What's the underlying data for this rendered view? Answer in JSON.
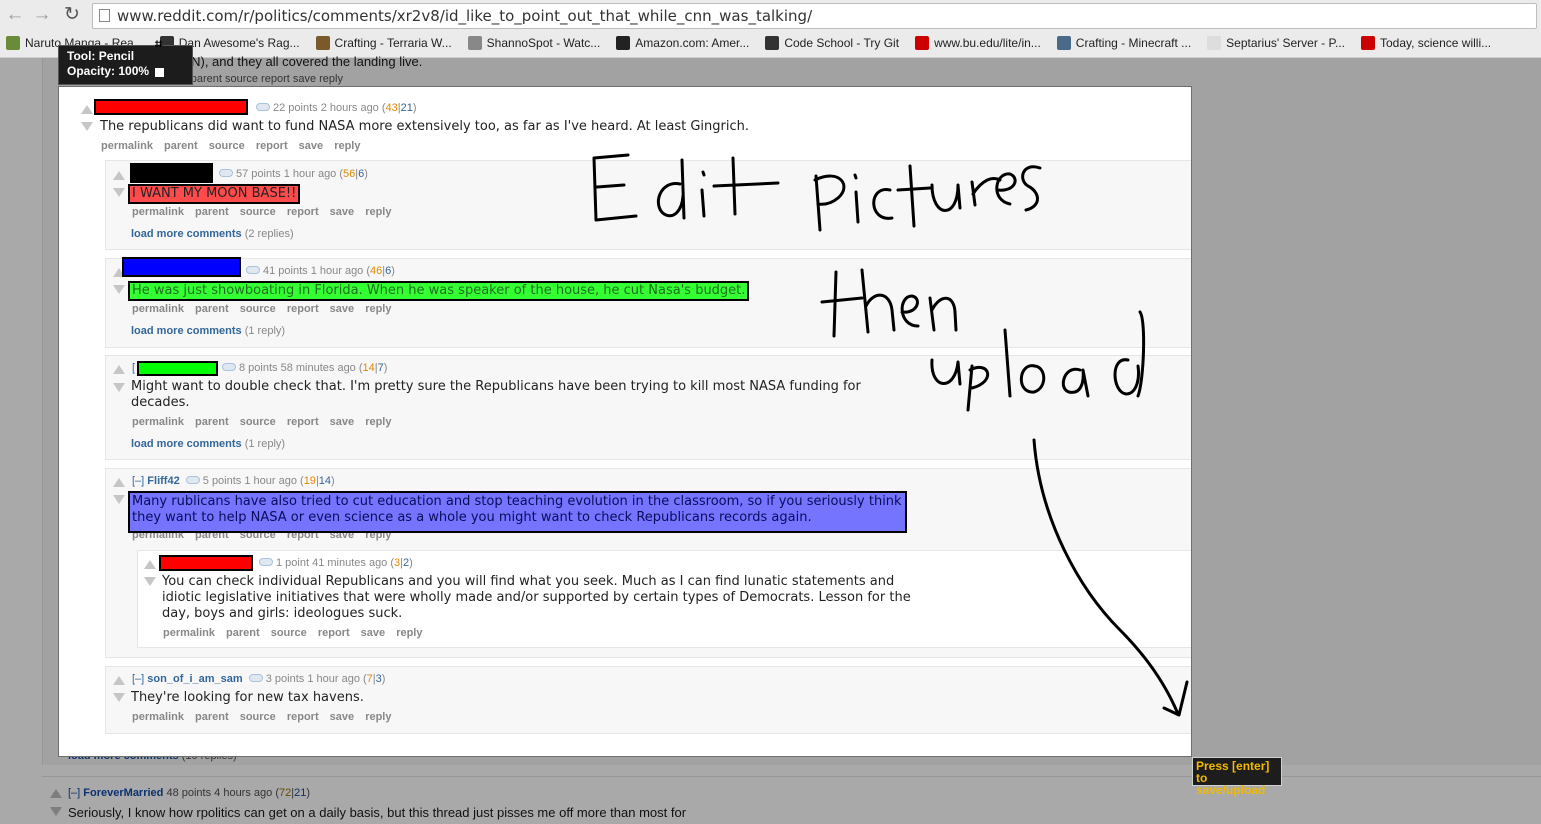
{
  "browser": {
    "url": "www.reddit.com/r/politics/comments/xr2v8/id_like_to_point_out_that_while_cnn_was_talking/",
    "bookmarks": [
      {
        "label": "Naruto Manga - Rea...",
        "color": "#6a8b3a"
      },
      {
        "label": "Dan Awesome's Rag...",
        "color": "#333333"
      },
      {
        "label": "Crafting - Terraria W...",
        "color": "#7a5a2a"
      },
      {
        "label": "ShannoSpot - Watc...",
        "color": "#888888"
      },
      {
        "label": "Amazon.com: Amer...",
        "color": "#222222"
      },
      {
        "label": "Code School - Try Git",
        "color": "#333333"
      },
      {
        "label": "www.bu.edu/lite/in...",
        "color": "#cc0000"
      },
      {
        "label": "Crafting - Minecraft ...",
        "color": "#4a6a8a"
      },
      {
        "label": "Septarius' Server - P...",
        "color": "#dddddd"
      },
      {
        "label": "Today, science willi...",
        "color": "#cc0000"
      }
    ]
  },
  "tool": {
    "name": "Tool: Pencil",
    "opacity": "Opacity: 100%"
  },
  "background": {
    "top_text": "(CNN), and they all covered the landing live.",
    "top_actions": "permalink  parent  source  report  save  reply",
    "load_more": "load more comments",
    "load_more_count": "(10 replies)",
    "bottom_user": "ForeverMarried",
    "bottom_points": "48 points 4 hours ago",
    "bottom_up": "72",
    "bottom_down": "21",
    "bottom_toggle": "[–]",
    "bottom_body": "Seriously, I know how rpolitics can get on a daily basis, but this thread just pisses me off more than most for"
  },
  "comments": [
    {
      "id": "c1",
      "points": "22 points 2 hours ago",
      "up": "43",
      "down": "21",
      "body": "The republicans did want to fund NASA more extensively too, as far as I've heard. At least Gingrich.",
      "actions": "permalink parent source report save reply"
    },
    {
      "id": "c2",
      "points": "57 points 1 hour ago",
      "up": "56",
      "down": "6",
      "body": "I WANT MY MOON BASE!!",
      "actions": "permalink parent source report save reply",
      "load_more": "load more comments",
      "load_more_count": "(2 replies)"
    },
    {
      "id": "c3",
      "points": "41 points 1 hour ago",
      "up": "46",
      "down": "6",
      "body": "He was just showboating in Florida. When he was speaker of the house, he cut Nasa's budget.",
      "actions": "permalink parent source report save reply",
      "load_more": "load more comments",
      "load_more_count": "(1 reply)"
    },
    {
      "id": "c4",
      "prefix": "[",
      "points": "8 points 58 minutes ago",
      "up": "14",
      "down": "7",
      "body": "Might want to double check that. I'm pretty sure the Republicans have been trying to kill most NASA funding for decades.",
      "actions": "permalink parent source report save reply",
      "load_more": "load more comments",
      "load_more_count": "(1 reply)"
    },
    {
      "id": "c5",
      "toggle": "[–]",
      "user": "Fliff42",
      "points": "5 points 1 hour ago",
      "up": "19",
      "down": "14",
      "body": "Many rublicans have also tried to cut education and stop teaching evolution in the classroom, so if you seriously think they want to help NASA or even science as a whole you might want to check Republicans records again.",
      "actions": "permalink parent source report save reply"
    },
    {
      "id": "c6",
      "points": "1 point 41 minutes ago",
      "up": "3",
      "down": "2",
      "body": "You can check individual Republicans and you will find what you seek. Much as I can find lunatic statements and idiotic legislative initiatives that were wholly made and/or supported by certain types of Democrats. Lesson for the day, boys and girls: ideologues suck.",
      "actions": "permalink parent source report save reply"
    },
    {
      "id": "c7",
      "toggle": "[–]",
      "user": "son_of_i_am_sam",
      "points": "3 points 1 hour ago",
      "up": "7",
      "down": "3",
      "body": "They're looking for new tax havens.",
      "actions": "permalink parent source report save reply"
    }
  ],
  "annotation_colors": {
    "red": "#ff0000",
    "black": "#000000",
    "blue": "#0000ff",
    "green": "#00ff00",
    "highlight_red": "#ff4b4b",
    "highlight_green": "#33ff33",
    "highlight_blue": "#7474ff"
  },
  "save_button": {
    "line1": "Press [enter]",
    "line2": "to save/upload"
  }
}
